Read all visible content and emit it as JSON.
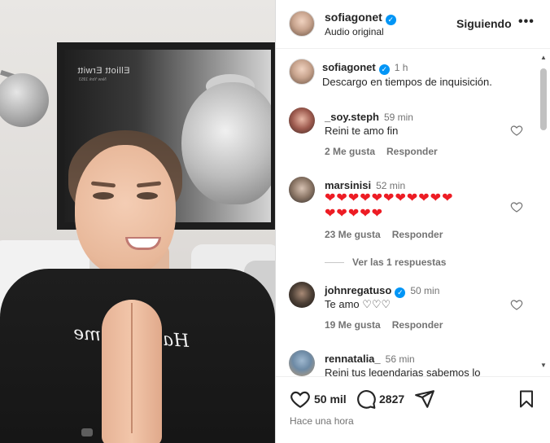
{
  "media": {
    "poster_title": "Elliott Erwitt",
    "poster_subtitle": "New York 1953",
    "shirt_text": "Hall of Fame"
  },
  "header": {
    "username": "sofiagonet",
    "audio": "Audio original",
    "follow_label": "Siguiendo",
    "more_label": "•••"
  },
  "caption": {
    "username": "sofiagonet",
    "time": "1 h",
    "text": "Descargo en tiempos de inquisición."
  },
  "comments": [
    {
      "username": "_soy.steph",
      "time": "59 min",
      "text": "Reini te amo fin",
      "likes": "2 Me gusta",
      "reply": "Responder"
    },
    {
      "username": "marsinisi",
      "time": "52 min",
      "text_line1": "❤❤❤❤❤❤❤❤❤❤❤",
      "text_line2": "❤❤❤❤❤",
      "likes": "23 Me gusta",
      "reply": "Responder",
      "view_replies": "Ver las 1 respuestas"
    },
    {
      "username": "johnregatuso",
      "time": "50 min",
      "text": "Te amo ♡♡♡",
      "likes": "19 Me gusta",
      "reply": "Responder"
    },
    {
      "username": "rennatalia_",
      "time": "56 min",
      "text": "Reini tus legendarias sabemos lo"
    }
  ],
  "footer": {
    "likes": "50 mil",
    "comments": "2827",
    "time": "Hace una hora"
  },
  "colors": {
    "verified": "#0095f6",
    "text": "#262626",
    "secondary": "#737373",
    "heart_red": "#ed1c24"
  },
  "icons": [
    "verified-badge-icon",
    "more-icon",
    "heart-icon",
    "comment-icon",
    "share-icon",
    "bookmark-icon"
  ]
}
